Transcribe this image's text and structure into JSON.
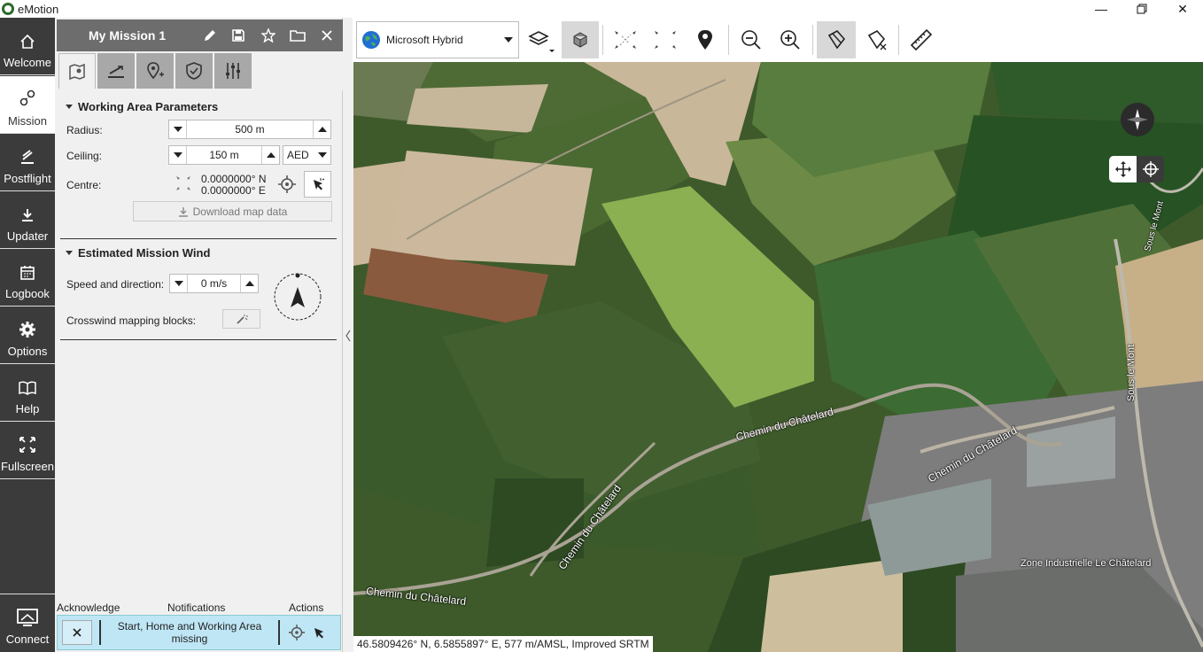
{
  "window": {
    "title": "eMotion"
  },
  "nav": {
    "items": [
      {
        "label": "Welcome"
      },
      {
        "label": "Mission"
      },
      {
        "label": "Postflight"
      },
      {
        "label": "Updater"
      },
      {
        "label": "Logbook"
      },
      {
        "label": "Options"
      },
      {
        "label": "Help"
      },
      {
        "label": "Fullscreen"
      }
    ],
    "connect": "Connect"
  },
  "panel": {
    "title": "My Mission 1",
    "working_area": {
      "heading": "Working Area Parameters",
      "radius_label": "Radius:",
      "radius_value": "500 m",
      "ceiling_label": "Ceiling:",
      "ceiling_value": "150 m",
      "ceiling_ref": "AED",
      "centre_label": "Centre:",
      "centre_lat": "0.0000000° N",
      "centre_lon": "0.0000000° E",
      "download_label": "Download map data"
    },
    "wind": {
      "heading": "Estimated Mission Wind",
      "speed_label": "Speed and direction:",
      "speed_value": "0 m/s",
      "crosswind_label": "Crosswind mapping blocks:"
    },
    "notifications": {
      "col_ack": "Acknowledge",
      "col_notif": "Notifications",
      "col_actions": "Actions",
      "message": "Start, Home and Working Area missing"
    }
  },
  "toolbar": {
    "map_source": "Microsoft Hybrid"
  },
  "map": {
    "labels": {
      "road1": "Chemin du Châtelard",
      "road2": "Chemin du Châtelard",
      "road3": "Chemin du Châtelard",
      "road4": "Chemin du Châtelard",
      "road5": "Sous le Mont",
      "road6": "Sous le Mont",
      "zone": "Zone Industrielle Le Châtelard"
    },
    "status": "46.5809426° N, 6.5855897° E, 577 m/AMSL, Improved SRTM"
  },
  "colors": {
    "nav_bg": "#3b3b3b",
    "panel_header": "#6d6d6d",
    "notif_bg": "#bfe6f5"
  }
}
